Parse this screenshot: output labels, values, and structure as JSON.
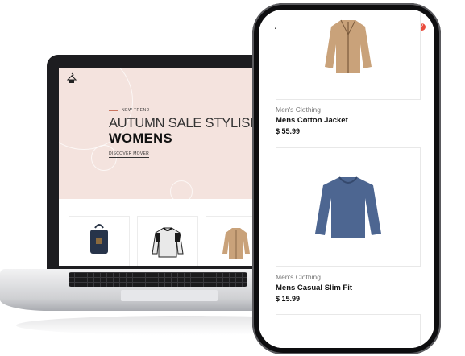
{
  "laptop": {
    "hero": {
      "kicker": "NEW TREND",
      "title_line1": "AUTUMN SALE STYLISH",
      "title_line2": "WOMENS",
      "cta": "DISCOVER MOVER"
    },
    "products": [
      {
        "icon": "backpack-icon"
      },
      {
        "icon": "sweater-icon"
      },
      {
        "icon": "jacket-icon"
      }
    ]
  },
  "phone": {
    "cart_count": "2",
    "products": [
      {
        "category": "Men's Clothing",
        "name": "Mens Cotton Jacket",
        "price": "$ 55.99"
      },
      {
        "category": "Men's Clothing",
        "name": "Mens Casual Slim Fit",
        "price": "$ 15.99"
      }
    ]
  },
  "colors": {
    "hero_bg": "#f4e3de",
    "accent": "#c9745f",
    "badge": "#e94b3c",
    "sweater": "#4d6691",
    "jacket": "#c9a27a"
  }
}
